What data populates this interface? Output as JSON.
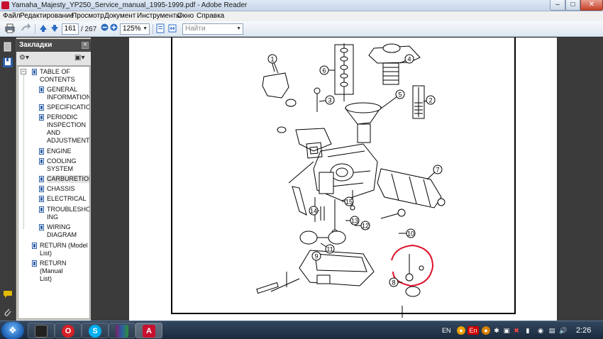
{
  "window": {
    "title": "Yamaha_Majesty_YP250_Service_manual_1995-1999.pdf - Adobe Reader",
    "min_label": "–",
    "max_label": "□",
    "close_label": "✕"
  },
  "menu": {
    "items": [
      "Файл",
      "Редактирование",
      "Просмотр",
      "Документ",
      "Инструменты",
      "Окно",
      "Справка"
    ]
  },
  "toolbar": {
    "current_page": "161",
    "total_pages": "/ 267",
    "zoom": "125%",
    "find_placeholder": "Найти"
  },
  "bookmarks": {
    "header": "Закладки",
    "items": [
      {
        "lines": [
          "TABLE OF",
          "CONTENTS"
        ]
      },
      {
        "lines": [
          "GENERAL",
          "INFORMATION"
        ]
      },
      {
        "lines": [
          "SPECIFICATIONS"
        ]
      },
      {
        "lines": [
          "PERIODIC",
          "INSPECTION",
          "AND",
          "ADJUSTMENT"
        ]
      },
      {
        "lines": [
          "ENGINE"
        ]
      },
      {
        "lines": [
          "COOLING",
          "SYSTEM"
        ]
      },
      {
        "lines": [
          "CARBURETION"
        ]
      },
      {
        "lines": [
          "CHASSIS"
        ]
      },
      {
        "lines": [
          "ELECTRICAL"
        ]
      },
      {
        "lines": [
          "TROUBLESHOOT",
          "ING"
        ]
      },
      {
        "lines": [
          "WIRING",
          "DIAGRAM"
        ]
      },
      {
        "lines": [
          "RETURN (Model",
          "List)"
        ]
      },
      {
        "lines": [
          "RETURN (Manual",
          "List)"
        ]
      }
    ]
  },
  "diagram": {
    "callouts": [
      "1",
      "2",
      "3",
      "4",
      "5",
      "6",
      "7",
      "8",
      "9",
      "10",
      "11",
      "12",
      "13",
      "14",
      "15"
    ]
  },
  "taskbar": {
    "lang": "EN",
    "clock": "2:26"
  },
  "colors": {
    "annotation_red": "#e0102a",
    "accent_blue": "#2d5fa8"
  }
}
